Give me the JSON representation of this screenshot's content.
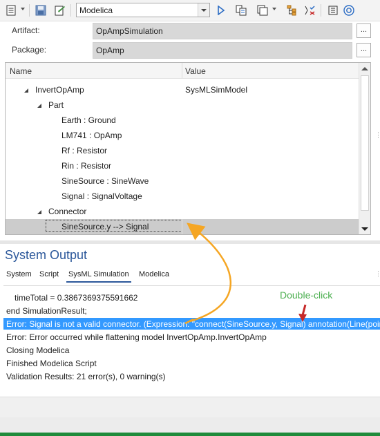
{
  "toolbar": {
    "language_combo": "Modelica",
    "icons": [
      "properties-icon",
      "save-icon",
      "edit-icon",
      "run-icon",
      "generate-icon",
      "documents-icon",
      "hierarchy-icon",
      "validate-icon",
      "help-icon"
    ]
  },
  "artifact": {
    "label": "Artifact:",
    "value": "OpAmpSimulation",
    "button": "..."
  },
  "package": {
    "label": "Package:",
    "value": "OpAmp",
    "button": "..."
  },
  "grid": {
    "col_name": "Name",
    "col_value": "Value",
    "rows": [
      {
        "name": "InvertOpAmp",
        "value": "SysMLSimModel"
      },
      {
        "name": "Part",
        "value": ""
      },
      {
        "name": "Earth : Ground",
        "value": ""
      },
      {
        "name": "LM741 : OpAmp",
        "value": ""
      },
      {
        "name": "Rf : Resistor",
        "value": ""
      },
      {
        "name": "Rin : Resistor",
        "value": ""
      },
      {
        "name": "SineSource : SineWave",
        "value": ""
      },
      {
        "name": "Signal : SignalVoltage",
        "value": ""
      },
      {
        "name": "Connector",
        "value": ""
      },
      {
        "name": "SineSource.y --> Signal",
        "value": ""
      }
    ]
  },
  "system_output": {
    "title": "System Output",
    "tabs": [
      "System",
      "Script",
      "SysML Simulation",
      "Modelica"
    ],
    "active_tab": "SysML Simulation",
    "lines": [
      "timeTotal = 0.3867369375591662",
      "end SimulationResult;",
      "Error: Signal is not a valid connector. (Expression: \"connect(SineSource.y, Signal) annotation(Line(points",
      "Error: Error occurred while flattening model InvertOpAmp.InvertOpAmp",
      "Closing Modelica",
      "Finished Modelica Script",
      "Validation Results: 21 error(s), 0 warning(s)"
    ]
  },
  "annotation": {
    "text": "Double-click",
    "color": "#4caf50",
    "arrow_color": "#f5a623",
    "pointer_color": "#c62828"
  },
  "colors": {
    "accent": "#2b579a",
    "selection": "#3399ff",
    "status_bar": "#1f8b3b"
  }
}
